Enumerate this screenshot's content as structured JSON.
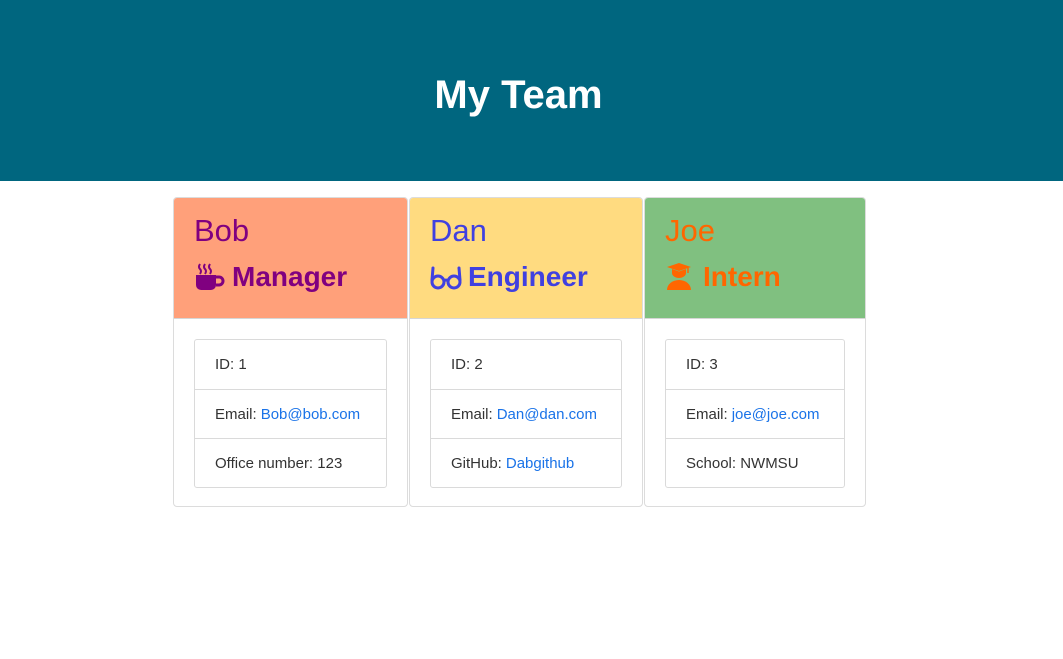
{
  "header": {
    "title": "My Team",
    "background": "#00667f"
  },
  "cards": [
    {
      "name": "Bob",
      "role": "Manager",
      "icon": "coffee-mug-icon",
      "header_color": "#ffa07a",
      "text_color": "#800080",
      "id_label": "ID: 1",
      "email_label": "Email:",
      "email": "Bob@bob.com",
      "extra_label": "Office number: 123",
      "extra_link": ""
    },
    {
      "name": "Dan",
      "role": "Engineer",
      "icon": "glasses-icon",
      "header_color": "#ffdb80",
      "text_color": "#4040e0",
      "id_label": "ID: 2",
      "email_label": "Email:",
      "email": "Dan@dan.com",
      "extra_label": "GitHub:",
      "extra_link": "Dabgithub"
    },
    {
      "name": "Joe",
      "role": "Intern",
      "icon": "graduate-icon",
      "header_color": "#80c080",
      "text_color": "#ff6600",
      "id_label": "ID: 3",
      "email_label": "Email:",
      "email": "joe@joe.com",
      "extra_label": "School: NWMSU",
      "extra_link": ""
    }
  ]
}
